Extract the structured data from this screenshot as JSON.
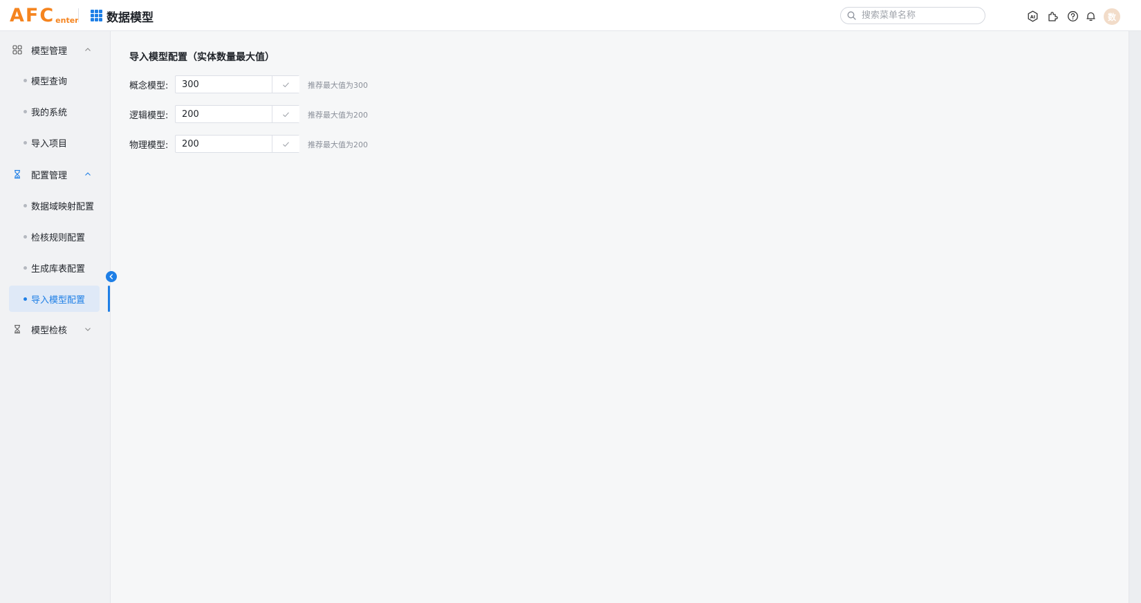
{
  "header": {
    "logo_big": "AFC",
    "logo_small": "enter",
    "app_title": "数据模型",
    "search_placeholder": "搜索菜单名称",
    "avatar_text": "数",
    "icons": [
      "ai-icon",
      "plugin-icon",
      "help-icon",
      "bell-icon"
    ]
  },
  "sidebar": {
    "groups": [
      {
        "label": "模型管理",
        "icon": "grid-icon",
        "expanded": true,
        "items": [
          "模型查询",
          "我的系统",
          "导入项目"
        ]
      },
      {
        "label": "配置管理",
        "icon": "hourglass-icon",
        "expanded": true,
        "items": [
          "数据域映射配置",
          "检核规则配置",
          "生成库表配置",
          "导入模型配置"
        ]
      },
      {
        "label": "模型检核",
        "icon": "hourglass-icon",
        "expanded": false,
        "items": []
      }
    ],
    "active_item": "导入模型配置"
  },
  "main": {
    "title": "导入模型配置（实体数量最大值）",
    "rows": [
      {
        "label": "概念模型:",
        "value": "300",
        "hint": "推荐最大值为300"
      },
      {
        "label": "逻辑模型:",
        "value": "200",
        "hint": "推荐最大值为200"
      },
      {
        "label": "物理模型:",
        "value": "200",
        "hint": "推荐最大值为200"
      }
    ]
  },
  "colors": {
    "accent": "#1e7fe6",
    "logo": "#f5841f",
    "active_bg": "#dfe9f7"
  }
}
